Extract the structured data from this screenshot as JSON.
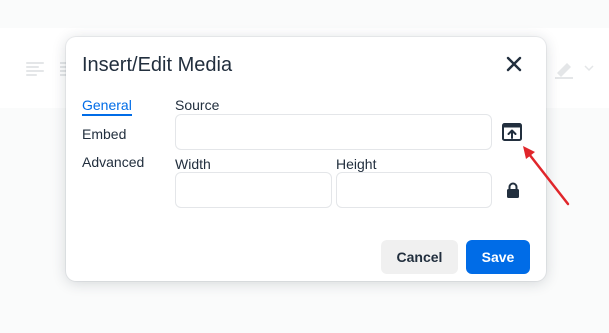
{
  "dialog": {
    "title": "Insert/Edit Media",
    "tabs": [
      {
        "label": "General"
      },
      {
        "label": "Embed"
      },
      {
        "label": "Advanced"
      }
    ],
    "fields": {
      "source_label": "Source",
      "source_value": "",
      "width_label": "Width",
      "width_value": "",
      "height_label": "Height",
      "height_value": ""
    },
    "buttons": {
      "cancel": "Cancel",
      "save": "Save"
    }
  },
  "icons": {
    "close": "close-icon",
    "upload": "upload-icon",
    "lock": "lock-icon"
  },
  "colors": {
    "accent": "#006ce7",
    "annotation_arrow": "#e0262b"
  }
}
